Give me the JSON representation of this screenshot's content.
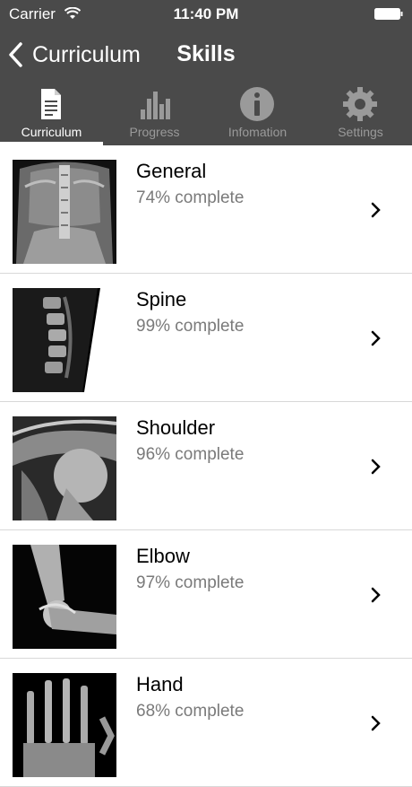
{
  "status_bar": {
    "carrier": "Carrier",
    "time": "11:40 PM"
  },
  "nav": {
    "back_label": "Curriculum",
    "title": "Skills"
  },
  "tabs": [
    {
      "label": "Curriculum",
      "icon": "document-icon",
      "active": true
    },
    {
      "label": "Progress",
      "icon": "bar-chart-icon",
      "active": false
    },
    {
      "label": "Infomation",
      "icon": "info-icon",
      "active": false
    },
    {
      "label": "Settings",
      "icon": "gear-icon",
      "active": false
    }
  ],
  "skills": [
    {
      "title": "General",
      "subtitle": "74% complete",
      "image": "abdomen-xray"
    },
    {
      "title": "Spine",
      "subtitle": "99% complete",
      "image": "spine-xray"
    },
    {
      "title": "Shoulder",
      "subtitle": "96% complete",
      "image": "shoulder-xray"
    },
    {
      "title": "Elbow",
      "subtitle": "97% complete",
      "image": "elbow-xray"
    },
    {
      "title": "Hand",
      "subtitle": "68% complete",
      "image": "hand-xray"
    }
  ],
  "colors": {
    "bar": "#4a4a4a",
    "active_tab": "#ffffff",
    "inactive_tab": "#9a9a9a",
    "subtitle": "#7a7a7a"
  }
}
